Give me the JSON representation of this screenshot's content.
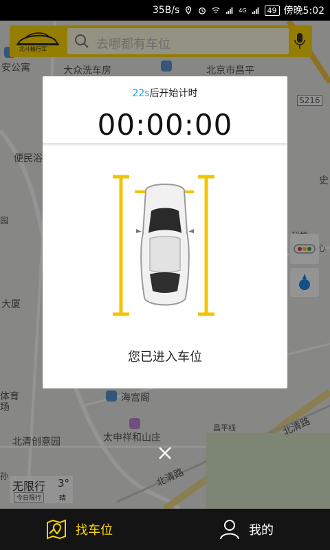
{
  "status_bar": {
    "speed": "35B/s",
    "network_label": "4G",
    "battery": "49",
    "time": "傍晚5:02"
  },
  "search": {
    "logo_text": "北斗精行军",
    "placeholder": "去哪都有车位"
  },
  "map_labels": {
    "l1": "安公寓",
    "l2": "大众洗车房",
    "l3": "北京市昌平",
    "l4": "S216",
    "l5": "便民浴",
    "l6": "大厦",
    "l7": "体育",
    "l8": "场",
    "l9": "海宫阁",
    "l10": "北清创意园",
    "l11": "太申祥和山庄",
    "l12": "昌平线",
    "l13": "北清路",
    "l14": "北清路",
    "l15": "中心",
    "l16": "科技",
    "l17": "史",
    "l18": "园",
    "l19": "孙"
  },
  "limit": {
    "title": "无限行",
    "sub": "今日限行",
    "temperature": "3°",
    "weather": "晴"
  },
  "dialog": {
    "countdown_seconds": "22s",
    "countdown_suffix": "后开始计时",
    "timer": "00:00:00",
    "status": "您已进入车位"
  },
  "nav": {
    "find_label": "找车位",
    "mine_label": "我的"
  },
  "colors": {
    "accent_yellow": "#ffd800",
    "timer_blue": "#1ea2e0",
    "nav_bg": "#141414"
  }
}
